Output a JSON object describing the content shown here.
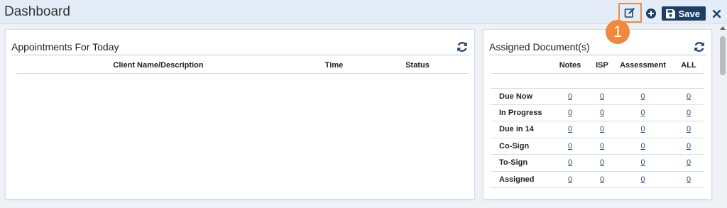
{
  "page": {
    "title": "Dashboard"
  },
  "toolbar": {
    "edit_icon": "edit-icon",
    "add_icon": "plus-circle-icon",
    "save_label": "Save",
    "close_icon": "close-icon"
  },
  "callout": {
    "number": "1",
    "color": "#f0883e"
  },
  "appointments": {
    "title": "Appointments For Today",
    "columns": [
      "Client Name/Description",
      "Time",
      "Status"
    ],
    "rows": []
  },
  "documents": {
    "title": "Assigned Document(s)",
    "columns": [
      "Notes",
      "ISP",
      "Assessment",
      "ALL"
    ],
    "rows": [
      {
        "label": "Due Now",
        "values": [
          "0",
          "0",
          "0",
          "0"
        ]
      },
      {
        "label": "In Progress",
        "values": [
          "0",
          "0",
          "0",
          "0"
        ]
      },
      {
        "label": "Due in 14",
        "values": [
          "0",
          "0",
          "0",
          "0"
        ]
      },
      {
        "label": "Co-Sign",
        "values": [
          "0",
          "0",
          "0",
          "0"
        ]
      },
      {
        "label": "To-Sign",
        "values": [
          "0",
          "0",
          "0",
          "0"
        ]
      },
      {
        "label": "Assigned",
        "values": [
          "0",
          "0",
          "0",
          "0"
        ]
      }
    ]
  },
  "colors": {
    "accent": "#1e3f64",
    "highlight": "#f0883e",
    "link": "#2a4a84"
  }
}
